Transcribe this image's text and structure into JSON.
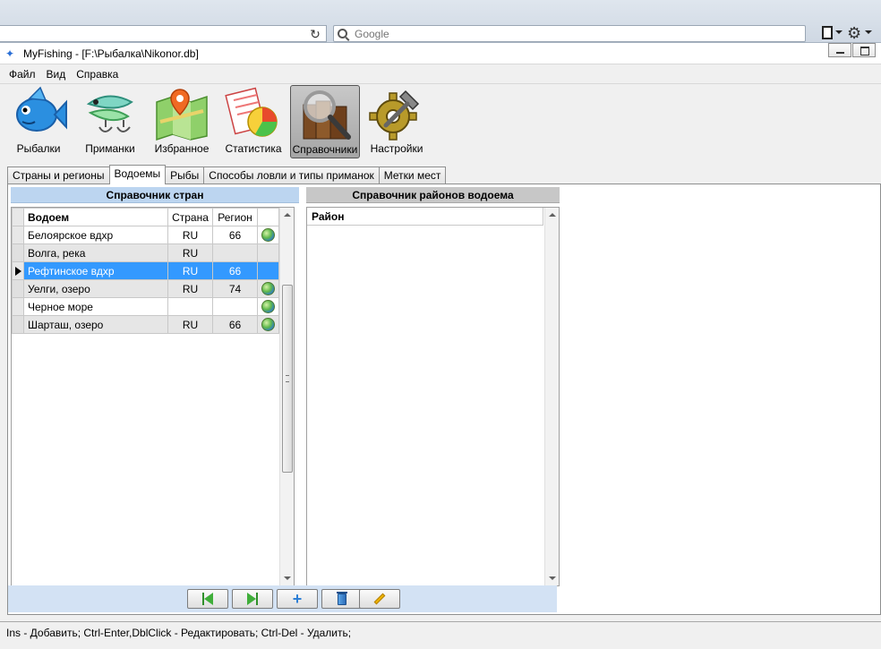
{
  "browser": {
    "search_placeholder": "Google",
    "icons": [
      "reload-icon",
      "search-icon",
      "page-icon",
      "gear-icon"
    ]
  },
  "window": {
    "title": "MyFishing - [F:\\Рыбалка\\Nikonor.db]"
  },
  "menu": {
    "items": [
      "Файл",
      "Вид",
      "Справка"
    ]
  },
  "toolbar": {
    "buttons": [
      {
        "label": "Рыбалки",
        "icon": "fish-icon",
        "selected": false
      },
      {
        "label": "Приманки",
        "icon": "lure-icon",
        "selected": false
      },
      {
        "label": "Избранное",
        "icon": "map-pin-icon",
        "selected": false
      },
      {
        "label": "Статистика",
        "icon": "pie-chart-icon",
        "selected": false
      },
      {
        "label": "Справочники",
        "icon": "books-magnifier-icon",
        "selected": true
      },
      {
        "label": "Настройки",
        "icon": "gear-icon",
        "selected": false
      }
    ]
  },
  "tabs": [
    {
      "label": "Страны и регионы",
      "active": false
    },
    {
      "label": "Водоемы",
      "active": true
    },
    {
      "label": "Рыбы",
      "active": false
    },
    {
      "label": "Способы ловли и типы приманок",
      "active": false
    },
    {
      "label": "Метки мест",
      "active": false
    }
  ],
  "left_panel": {
    "title": "Справочник стран",
    "columns": [
      "Водоем",
      "Страна",
      "Регион"
    ],
    "rows": [
      {
        "name": "Белоярское вдхр",
        "country": "RU",
        "region": "66",
        "has_globe": true,
        "selected": false
      },
      {
        "name": "Волга, река",
        "country": "RU",
        "region": "",
        "has_globe": false,
        "selected": false
      },
      {
        "name": "Рефтинское вдхр",
        "country": "RU",
        "region": "66",
        "has_globe": false,
        "selected": true
      },
      {
        "name": "Уелги, озеро",
        "country": "RU",
        "region": "74",
        "has_globe": true,
        "selected": false
      },
      {
        "name": "Черное море",
        "country": "",
        "region": "",
        "has_globe": true,
        "selected": false
      },
      {
        "name": "Шарташ, озеро",
        "country": "RU",
        "region": "66",
        "has_globe": true,
        "selected": false
      }
    ]
  },
  "right_panel": {
    "title": "Справочник районов водоема",
    "columns": [
      "Район"
    ]
  },
  "nav_buttons": [
    "prev-arrow-icon",
    "next-arrow-icon",
    "plus-icon",
    "trash-icon",
    "pencil-icon"
  ],
  "status": {
    "text": "Ins - Добавить; Ctrl-Enter,DblClick - Редактировать; Ctrl-Del - Удалить;"
  },
  "colors": {
    "selection": "#3399ff",
    "left_header": "#bcd5f0",
    "right_header": "#c7c7c7",
    "nav_bar": "#d3e2f4"
  }
}
